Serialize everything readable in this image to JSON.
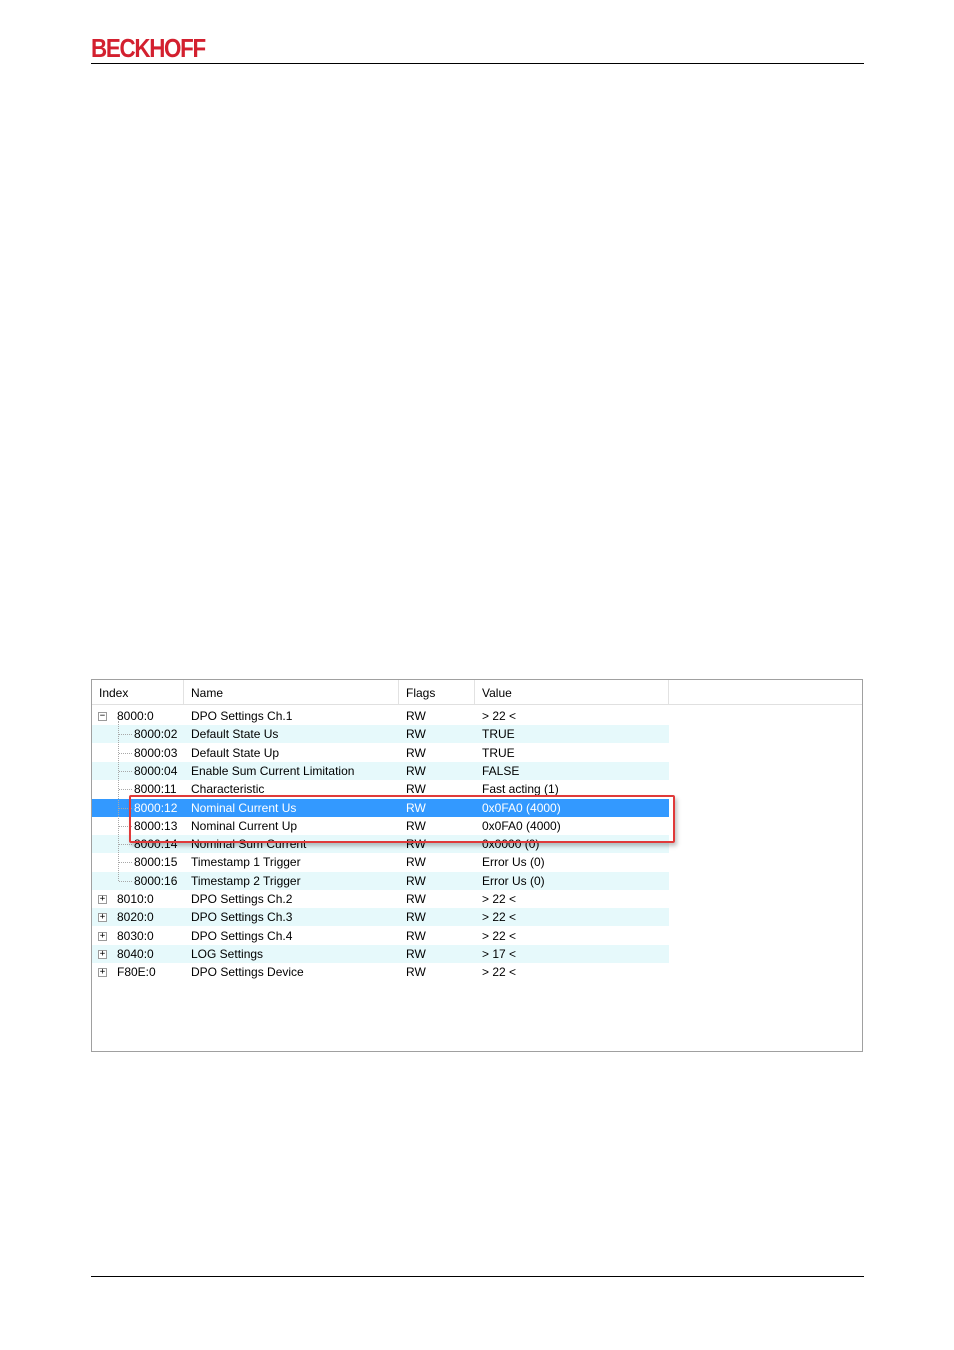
{
  "brand": "BECKHOFF",
  "columns": {
    "index": "Index",
    "name": "Name",
    "flags": "Flags",
    "value": "Value"
  },
  "rows": [
    {
      "index": "8000:0",
      "name": "DPO Settings Ch.1",
      "flags": "RW",
      "value": "> 22 <",
      "level": 0,
      "expander": "−"
    },
    {
      "index": "8000:02",
      "name": "Default State Us",
      "flags": "RW",
      "value": "TRUE",
      "level": 1
    },
    {
      "index": "8000:03",
      "name": "Default State Up",
      "flags": "RW",
      "value": "TRUE",
      "level": 1
    },
    {
      "index": "8000:04",
      "name": "Enable Sum Current Limitation",
      "flags": "RW",
      "value": "FALSE",
      "level": 1
    },
    {
      "index": "8000:11",
      "name": "Characteristic",
      "flags": "RW",
      "value": "Fast acting (1)",
      "level": 1
    },
    {
      "index": "8000:12",
      "name": "Nominal Current Us",
      "flags": "RW",
      "value": "0x0FA0 (4000)",
      "level": 1,
      "selected": true
    },
    {
      "index": "8000:13",
      "name": "Nominal Current Up",
      "flags": "RW",
      "value": "0x0FA0 (4000)",
      "level": 1
    },
    {
      "index": "8000:14",
      "name": "Nominal Sum Current",
      "flags": "RW",
      "value": "0x0000 (0)",
      "level": 1
    },
    {
      "index": "8000:15",
      "name": "Timestamp 1 Trigger",
      "flags": "RW",
      "value": "Error Us (0)",
      "level": 1
    },
    {
      "index": "8000:16",
      "name": "Timestamp 2 Trigger",
      "flags": "RW",
      "value": "Error Us (0)",
      "level": 1
    },
    {
      "index": "8010:0",
      "name": "DPO Settings Ch.2",
      "flags": "RW",
      "value": "> 22 <",
      "level": 0,
      "expander": "+"
    },
    {
      "index": "8020:0",
      "name": "DPO Settings Ch.3",
      "flags": "RW",
      "value": "> 22 <",
      "level": 0,
      "expander": "+"
    },
    {
      "index": "8030:0",
      "name": "DPO Settings Ch.4",
      "flags": "RW",
      "value": "> 22 <",
      "level": 0,
      "expander": "+"
    },
    {
      "index": "8040:0",
      "name": "LOG Settings",
      "flags": "RW",
      "value": "> 17 <",
      "level": 0,
      "expander": "+"
    },
    {
      "index": "F80E:0",
      "name": "DPO Settings Device",
      "flags": "RW",
      "value": "> 22 <",
      "level": 0,
      "expander": "+"
    }
  ],
  "colors": {
    "brand": "#d3202f",
    "selection": "#3399ff",
    "alt_row": "#e6f9fb",
    "highlight_border": "#e03a3a"
  }
}
